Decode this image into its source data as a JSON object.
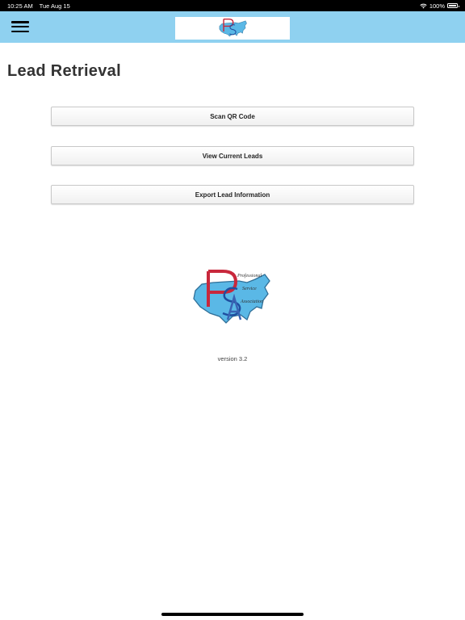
{
  "status_bar": {
    "time": "10:25 AM",
    "date": "Tue Aug 15",
    "battery": "100%",
    "icons": [
      "wifi-icon",
      "battery-icon"
    ]
  },
  "nav": {
    "menu_icon": "hamburger-menu-icon"
  },
  "logo": {
    "words": [
      "Professional",
      "Service",
      "Association"
    ],
    "colors": {
      "map": "#5ab8e6",
      "letter_p": "#c8283c",
      "letter_s": "#1f4fa0",
      "letter_a": "#3a64b4"
    }
  },
  "page": {
    "title": "Lead Retrieval"
  },
  "actions": {
    "scan": "Scan QR Code",
    "view": "View Current Leads",
    "export": "Export Lead Information"
  },
  "footer": {
    "version": "version 3.2"
  },
  "colors": {
    "nav_background": "#8fd1f0",
    "status_background": "#000000"
  }
}
